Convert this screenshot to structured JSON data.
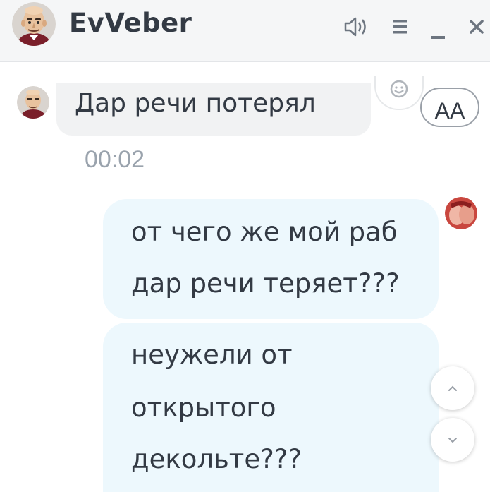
{
  "header": {
    "title": "EvVeber",
    "icons": [
      "avatar-caricature",
      "sound-icon",
      "menu-icon",
      "minimize-icon",
      "close-icon"
    ]
  },
  "messages": [
    {
      "direction": "incoming",
      "text": "Дар речи потерял",
      "time": "00:02"
    },
    {
      "direction": "outgoing",
      "lines": [
        "от чего же мой раб",
        "дар речи теряет???"
      ]
    },
    {
      "direction": "outgoing",
      "lines": [
        "неужели от",
        "открытого",
        "декольте???"
      ]
    }
  ],
  "controls": {
    "font_size_label": "AA",
    "emoji_icon": "smile-icon",
    "scroll_up_icon": "chevron-up-icon",
    "scroll_down_icon": "chevron-down-icon"
  },
  "colors": {
    "text": "#333a44",
    "incoming_bubble": "#f1f2f3",
    "outgoing_bubble": "#edf8fd",
    "timestamp": "#9aa3ad",
    "header_bg": "#f5f6f7"
  }
}
